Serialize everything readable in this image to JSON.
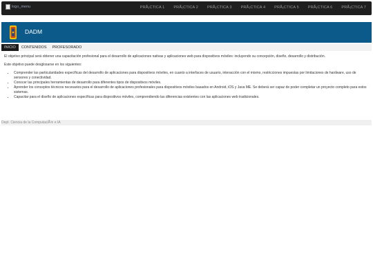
{
  "header": {
    "logo_alt": "logo_menu",
    "nav": [
      "PRÃ¡CTICA 1",
      "PRÃ¡CTICA 2",
      "PRÃ¡CTICA 3",
      "PRÃ¡CTICA 4",
      "PRÃ¡CTICA 5",
      "PRÃ¡CTICA 6",
      "PRÃ¡CTICA 7"
    ]
  },
  "banner": {
    "title": "DADM"
  },
  "tabs": [
    "INICIO",
    "CONTENIDOS",
    "PROFESORADO"
  ],
  "content": {
    "intro": "El objetivo principal será obtener una capacitación profesional para el desarrollo de aplicaciones nativas y aplicaciones web para dispositivos móviles: incluyendo su concepción, diseño, desarrollo y distribución.",
    "lead": "Este objetivo puede desglosarse en los siguientes:",
    "bullets": [
      "Comprender las particularidades específicas del desarrollo de aplicaciones para dispositivos móviles, en cuanto a interfaces de usuario, interacción con el mismo, restricciones impuestas por limitaciones de hardware, uso de sensores y conectividad.",
      "Conocer las principales herramientas de desarrollo para diferentes tipos de dispositivos móviles.",
      "Aprender los conceptos técnicos necesarios para el desarrollo de aplicaciones profesionales para dispositivos móviles basados en Android, iOS y Java ME. Se deberá ser capaz de poder completar un proyecto completo para estos sistemas.",
      "Capacitar para el diseño de aplicaciones específicas para dispositivos móviles, comprendiendo las diferencias existentes con las aplicaciones web tradicionales."
    ]
  },
  "footer": {
    "text": "Dept. Ciencia de la ComputaciÃ³n e IA"
  },
  "colors": {
    "banner": "#0c5a8a",
    "nav_bg": "#1f1f1f"
  }
}
